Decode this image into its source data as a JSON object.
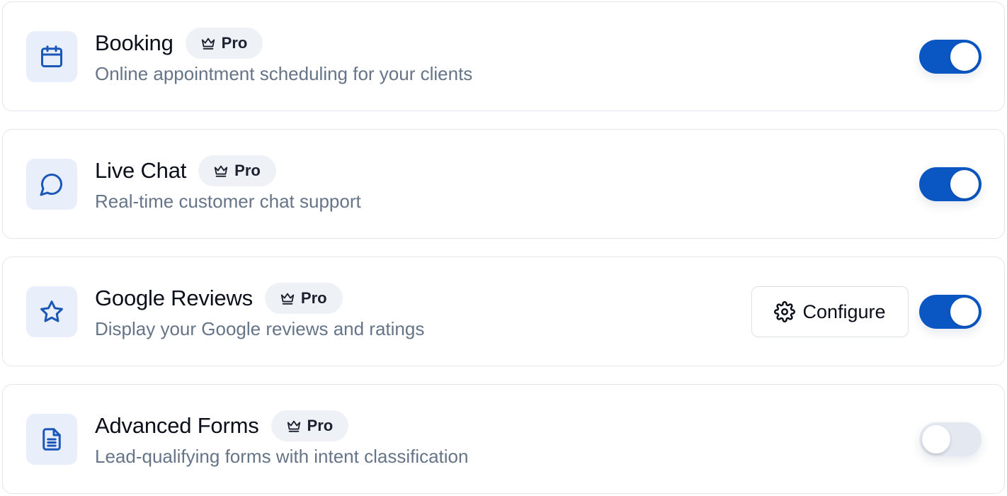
{
  "features": [
    {
      "title": "Booking",
      "badge": "Pro",
      "description": "Online appointment scheduling for your clients",
      "icon": "calendar-icon",
      "enabled": true
    },
    {
      "title": "Live Chat",
      "badge": "Pro",
      "description": "Real-time customer chat support",
      "icon": "chat-bubble-icon",
      "enabled": true
    },
    {
      "title": "Google Reviews",
      "badge": "Pro",
      "description": "Display your Google reviews and ratings",
      "icon": "star-icon",
      "enabled": true,
      "configure_label": "Configure"
    },
    {
      "title": "Advanced Forms",
      "badge": "Pro",
      "description": "Lead-qualifying forms with intent classification",
      "icon": "document-icon",
      "enabled": false
    }
  ],
  "colors": {
    "accent": "#0a56c2",
    "icon_tile_bg": "#e9eefb",
    "badge_bg": "#eef1f6",
    "toggle_off": "#e4e8f1",
    "description_text": "#667487"
  }
}
